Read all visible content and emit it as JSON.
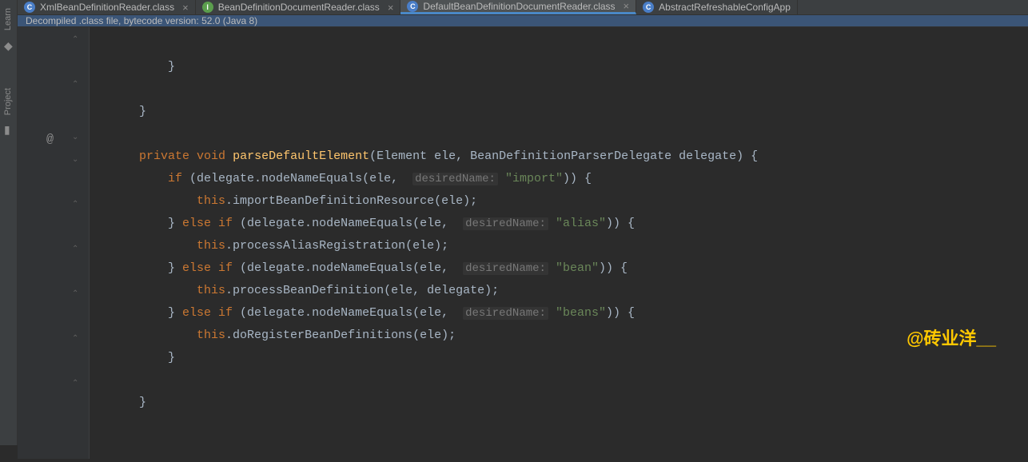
{
  "sidebar": {
    "learn_label": "Learn",
    "project_label": "Project"
  },
  "tabs": [
    {
      "label": "XmlBeanDefinitionReader.class",
      "icon_letter": "C",
      "icon_type": "class-c",
      "active": false
    },
    {
      "label": "BeanDefinitionDocumentReader.class",
      "icon_letter": "I",
      "icon_type": "class-i",
      "active": false
    },
    {
      "label": "DefaultBeanDefinitionDocumentReader.class",
      "icon_letter": "C",
      "icon_type": "class-c",
      "active": true
    },
    {
      "label": "AbstractRefreshableConfigApp",
      "icon_letter": "C",
      "icon_type": "class-c",
      "active": false,
      "no_close": true
    }
  ],
  "info_bar": "Decompiled .class file, bytecode version: 52.0 (Java 8)",
  "code": {
    "l1": "        }",
    "l2": "    }",
    "l3_kw1": "private",
    "l3_kw2": "void",
    "l3_method": "parseDefaultElement",
    "l3_rest": "(Element ele, BeanDefinitionParserDelegate delegate) {",
    "l4_kw": "if",
    "l4_a": " (delegate.nodeNameEquals(ele, ",
    "l4_hint": "desiredName:",
    "l4_str": "\"import\"",
    "l4_b": ")) {",
    "l5_kw": "this",
    "l5_rest": ".importBeanDefinitionResource(ele);",
    "l6a": "} ",
    "l6_kw": "else if",
    "l6_b": " (delegate.nodeNameEquals(ele, ",
    "l6_hint": "desiredName:",
    "l6_str": "\"alias\"",
    "l6_c": ")) {",
    "l7_kw": "this",
    "l7_rest": ".processAliasRegistration(ele);",
    "l8a": "} ",
    "l8_kw": "else if",
    "l8_b": " (delegate.nodeNameEquals(ele, ",
    "l8_hint": "desiredName:",
    "l8_str": "\"bean\"",
    "l8_c": ")) {",
    "l9_kw": "this",
    "l9_rest": ".processBeanDefinition(ele, delegate);",
    "l10a": "} ",
    "l10_kw": "else if",
    "l10_b": " (delegate.nodeNameEquals(ele, ",
    "l10_hint": "desiredName:",
    "l10_str": "\"beans\"",
    "l10_c": ")) {",
    "l11_kw": "this",
    "l11_rest": ".doRegisterBeanDefinitions(ele);",
    "l12": "        }",
    "l13": "    }"
  },
  "watermark": "@砖业洋__"
}
